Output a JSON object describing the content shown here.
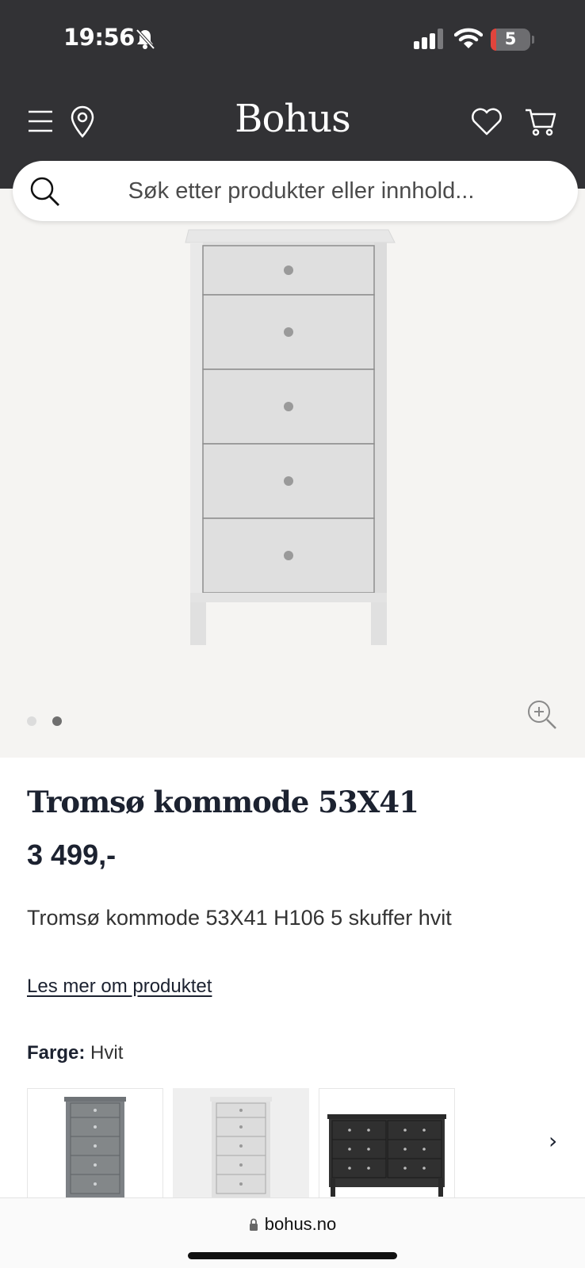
{
  "status_bar": {
    "time": "19:56",
    "battery_level": "5",
    "icons": [
      "bell-slash-icon",
      "cellular-signal-icon",
      "wifi-icon",
      "battery-icon"
    ]
  },
  "header": {
    "logo": "Bohus",
    "icons": [
      "menu-icon",
      "location-pin-icon",
      "heart-icon",
      "cart-icon"
    ],
    "background_color": "#323235"
  },
  "search": {
    "placeholder": "Søk etter produkter eller innhold..."
  },
  "gallery": {
    "image_count": 2,
    "active_index": 1,
    "background_color": "#f5f4f2"
  },
  "product": {
    "title": "Tromsø kommode 53X41",
    "price": "3 499,-",
    "description": "Tromsø kommode 53X41 H106 5 skuffer hvit",
    "read_more_label": "Les mer om produktet",
    "color_label": "Farge:",
    "color_value": "Hvit"
  },
  "color_options": [
    {
      "name": "grey",
      "selected": false
    },
    {
      "name": "white",
      "selected": true
    },
    {
      "name": "black",
      "selected": false
    }
  ],
  "browser": {
    "url": "bohus.no"
  }
}
